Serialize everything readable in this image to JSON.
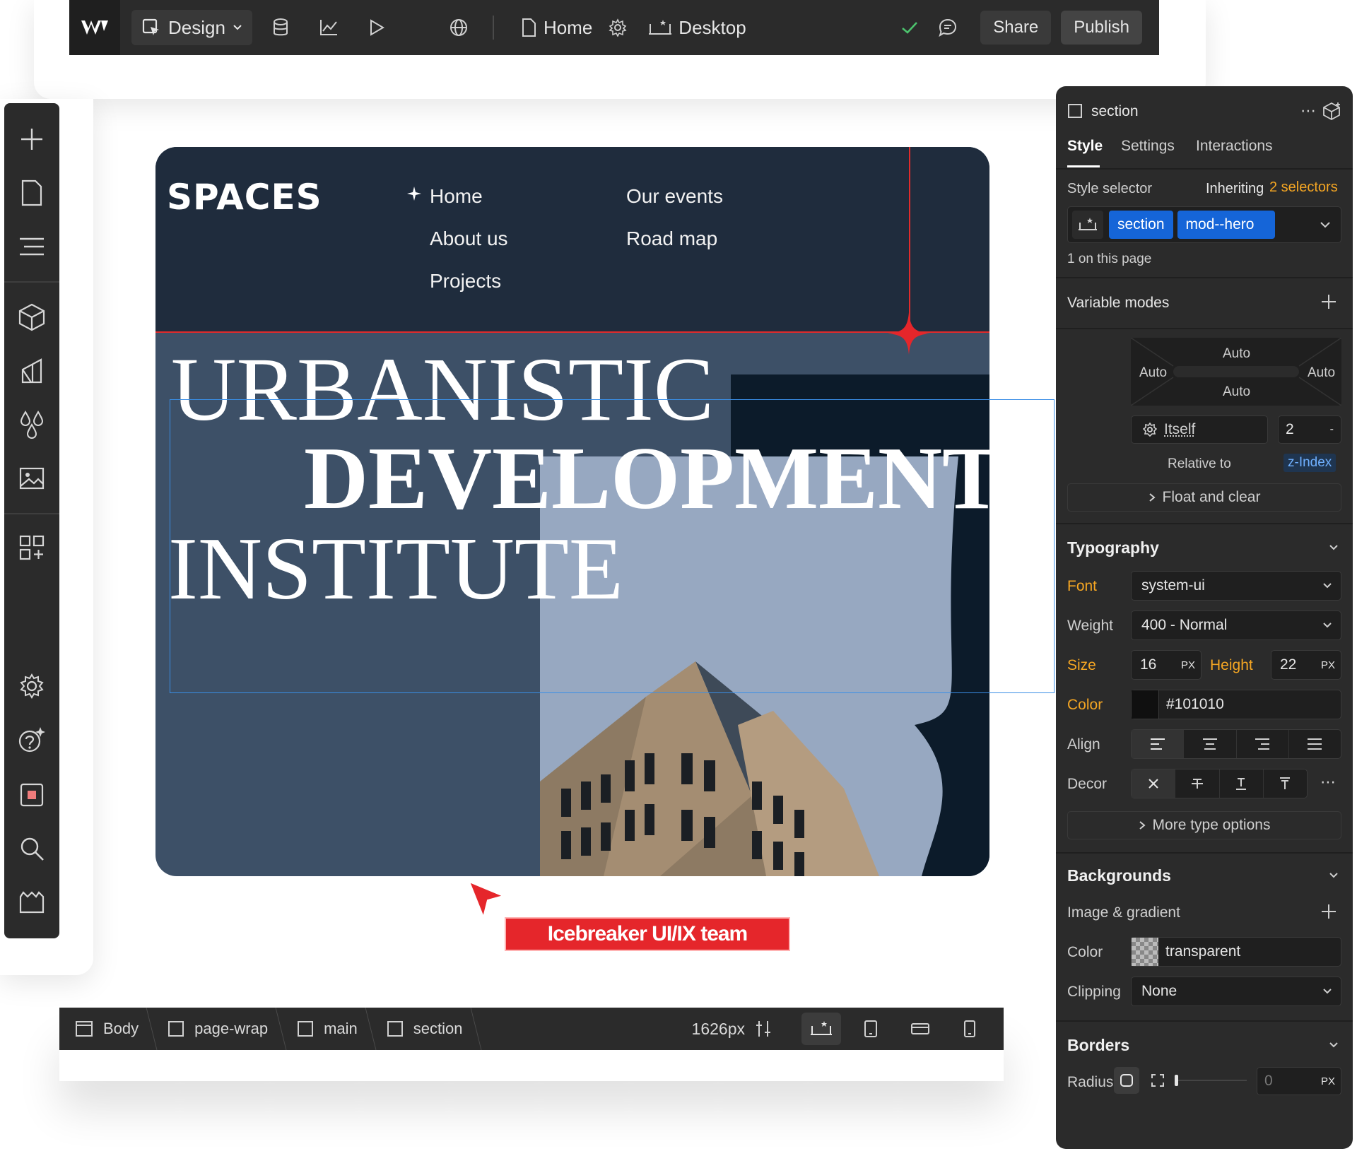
{
  "toolbar": {
    "mode_label": "Design",
    "page_label": "Home",
    "device_label": "Desktop",
    "share_label": "Share",
    "publish_label": "Publish"
  },
  "site": {
    "brand": "SPACES",
    "nav": {
      "home": "Home",
      "about": "About us",
      "projects": "Projects",
      "events": "Our events",
      "roadmap": "Road map"
    },
    "headline": {
      "line1": "URBANISTIC",
      "line2": "DEVELOPMENT",
      "line3": "INSTITUTE"
    }
  },
  "canvas": {
    "collaborator_tag": "Icebreaker UI/IX team"
  },
  "breadcrumb": {
    "items": [
      "Body",
      "page-wrap",
      "main",
      "section"
    ],
    "width_readout": "1626px"
  },
  "panel": {
    "element_name": "section",
    "tabs": [
      "Style",
      "Settings",
      "Interactions"
    ],
    "style_selector_label": "Style selector",
    "inheriting_label": "Inheriting",
    "selectors_count": "2 selectors",
    "chips": [
      "section",
      "mod--hero"
    ],
    "on_page": "1 on this page",
    "variable_modes": "Variable modes",
    "position": {
      "top": "Auto",
      "left": "Auto",
      "right": "Auto",
      "bottom": "Auto",
      "relative_select": "Itself",
      "z_value": "2",
      "z_unit": "-",
      "relative_to_label": "Relative to",
      "z_index_label": "z-Index"
    },
    "float_and_clear": "Float and clear",
    "typography": {
      "title": "Typography",
      "font_label": "Font",
      "font_value": "system-ui",
      "weight_label": "Weight",
      "weight_value": "400 - Normal",
      "size_label": "Size",
      "size_value": "16",
      "size_unit": "PX",
      "height_label": "Height",
      "height_value": "22",
      "height_unit": "PX",
      "color_label": "Color",
      "color_value": "#101010",
      "align_label": "Align",
      "decor_label": "Decor",
      "more_options": "More type options"
    },
    "backgrounds": {
      "title": "Backgrounds",
      "image_gradient": "Image & gradient",
      "color_label": "Color",
      "color_value": "transparent",
      "clipping_label": "Clipping",
      "clipping_value": "None"
    },
    "borders": {
      "title": "Borders",
      "radius_label": "Radius",
      "radius_value": "0",
      "radius_unit": "PX"
    }
  },
  "colors": {
    "accent_blue": "#1565d8",
    "orange_label": "#f5a623",
    "hero_bg": "#3d5067",
    "hero_nav_bg": "#1f2c3d",
    "accent_red": "#e5262b",
    "ui_dark": "#2b2b2b"
  }
}
